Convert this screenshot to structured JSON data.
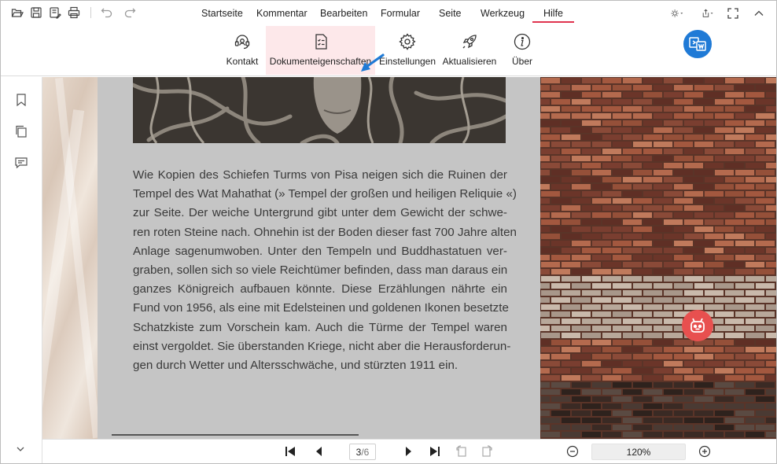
{
  "menu": {
    "items": [
      "Startseite",
      "Kommentar",
      "Bearbeiten",
      "Formular",
      "Seite",
      "Werkzeug",
      "Hilfe"
    ],
    "active": "Hilfe",
    "accent": "#e0344f"
  },
  "ribbon": {
    "contact": "Kontakt",
    "doc_props": "Dokumenteigenschaften",
    "settings": "Einstellungen",
    "update": "Aktualisieren",
    "about": "Über",
    "highlight_color": "#fde8ea",
    "arrow_color": "#1f7ad6"
  },
  "document": {
    "lines": [
      "Wie Kopien des Schiefen Turms von Pisa neigen sich die Ruinen der",
      "Tempel des Wat Mahathat (» Tempel der großen und heiligen Reliquie «)",
      "zur Seite. Der weiche Untergrund gibt unter dem Gewicht der schwe-",
      "ren roten Steine nach. Ohnehin ist der Boden dieser fast 700 Jahre alten",
      "Anlage sagenumwoben. Unter den Tempeln und Buddhastatuen ver-",
      "graben, sollen sich so viele Reichtümer befinden, dass man daraus ein",
      "ganzes Königreich aufbauen könnte. Diese Erzählungen nährte ein",
      "Fund von 1956, als eine mit Edelsteinen und goldenen Ikonen besetzte",
      "Schatzkiste zum Vorschein kam. Auch die Türme der Tempel waren",
      "einst vergoldet. Sie überstanden Kriege, nicht aber die Herausforderun-",
      "gen durch Wetter und Altersschwäche, und stürzten 1911 ein."
    ]
  },
  "status": {
    "current_page": "3",
    "page_sep": "/",
    "total_pages": "6",
    "zoom": "120%"
  },
  "colors": {
    "word_fab": "#1f7ad6",
    "ai_fab": "#e8504f"
  }
}
